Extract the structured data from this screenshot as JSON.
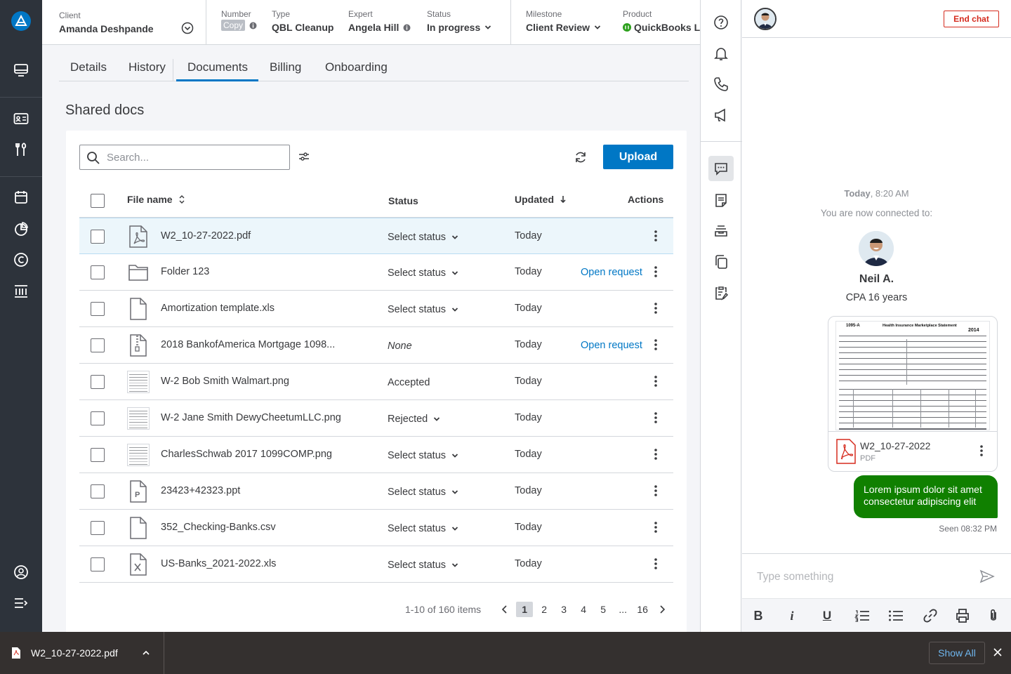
{
  "header": {
    "client": {
      "label": "Client",
      "value": "Amanda Deshpande"
    },
    "number": {
      "label": "Number",
      "copy": "Copy"
    },
    "type": {
      "label": "Type",
      "value": "QBL Cleanup"
    },
    "expert": {
      "label": "Expert",
      "value": "Angela Hill"
    },
    "status": {
      "label": "Status",
      "value": "In progress"
    },
    "milestone": {
      "label": "Milestone",
      "value": "Client Review"
    },
    "product": {
      "label": "Product",
      "value": "QuickBooks L"
    }
  },
  "tabs": [
    {
      "label": "Details"
    },
    {
      "label": "History"
    },
    {
      "label": "Documents"
    },
    {
      "label": "Billing"
    },
    {
      "label": "Onboarding"
    }
  ],
  "section_title": "Shared docs",
  "search": {
    "placeholder": "Search..."
  },
  "upload_label": "Upload",
  "columns": {
    "file_name": "File name",
    "status": "Status",
    "updated": "Updated",
    "actions": "Actions"
  },
  "files": [
    {
      "name": "W2_10-27-2022.pdf",
      "icon": "pdf-icon",
      "status": "Select status",
      "updated": "Today",
      "action": ""
    },
    {
      "name": "Folder 123",
      "icon": "folder-icon",
      "status": "Select status",
      "updated": "Today",
      "action": "Open request"
    },
    {
      "name": "Amortization template.xls",
      "icon": "file-icon",
      "status": "Select status",
      "updated": "Today",
      "action": ""
    },
    {
      "name": "2018 BankofAmerica Mortgage 1098...",
      "icon": "zip-file-icon",
      "status": "None",
      "updated": "Today",
      "action": "Open request"
    },
    {
      "name": "W-2 Bob Smith Walmart.png",
      "icon": "image-thumbnail",
      "status": "Accepted",
      "updated": "Today",
      "action": ""
    },
    {
      "name": "W-2 Jane Smith DewyCheetumLLC.png",
      "icon": "image-thumbnail",
      "status": "Rejected",
      "updated": "Today",
      "action": ""
    },
    {
      "name": "CharlesSchwab 2017 1099COMP.png",
      "icon": "image-thumbnail",
      "status": "Select status",
      "updated": "Today",
      "action": ""
    },
    {
      "name": "23423+42323.ppt",
      "icon": "ppt-file-icon",
      "status": "Select status",
      "updated": "Today",
      "action": ""
    },
    {
      "name": "352_Checking-Banks.csv",
      "icon": "file-icon",
      "status": "Select status",
      "updated": "Today",
      "action": ""
    },
    {
      "name": "US-Banks_2021-2022.xls",
      "icon": "excel-file-icon",
      "status": "Select status",
      "updated": "Today",
      "action": ""
    }
  ],
  "pagination": {
    "info": "1-10 of 160 items",
    "pages": [
      "1",
      "2",
      "3",
      "4",
      "5",
      "...",
      "16"
    ],
    "current": "1"
  },
  "chat": {
    "end_chat": "End chat",
    "time_day": "Today",
    "time_rest": ", 8:20 AM",
    "connected": "You are now connected to:",
    "expert_name": "Neil A.",
    "expert_title": "CPA 16 years",
    "attachment_name": "W2_10-27-2022",
    "attachment_type": "PDF",
    "message": "Lorem ipsum dolor sit amet consectetur adipiscing elit",
    "seen": "Seen 08:32 PM",
    "input_placeholder": "Type something",
    "form_title": "Health Insurance Marketplace Statement",
    "form_number": "1095-A",
    "form_year": "2014"
  },
  "download_bar": {
    "file": "W2_10-27-2022.pdf",
    "show_all": "Show All"
  },
  "colors": {
    "accent": "#0077c5",
    "chat_bubble": "#108000",
    "end_chat": "#d52b1e",
    "left_nav": "#2d333b"
  }
}
